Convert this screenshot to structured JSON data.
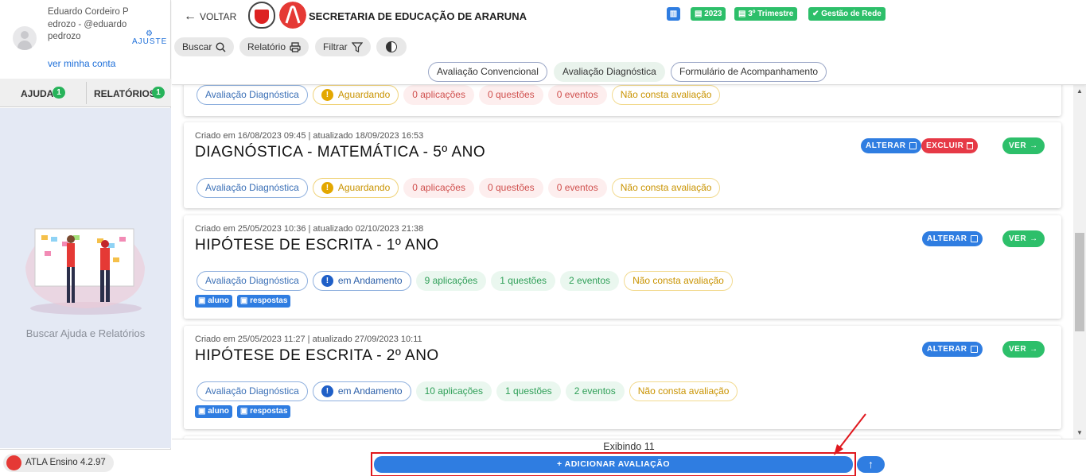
{
  "user": {
    "name": "Eduardo Cordeiro Pedrozo - @eduardopedrozo",
    "account_link": "ver minha conta",
    "settings_label": "AJUSTE"
  },
  "sidebar_tabs": [
    {
      "label": "AJUDA",
      "badge": "1"
    },
    {
      "label": "RELATÓRIOS",
      "badge": "1"
    }
  ],
  "help_text": "Buscar Ajuda e Relatórios",
  "version": "ATLA Ensino 4.2.97",
  "header": {
    "back_label": "VOLTAR",
    "title": "SECRETARIA DE EDUCAÇÃO DE ARARUNA",
    "pills": [
      "2023",
      "3º Trimestre",
      "Gestão de Rede"
    ],
    "tools": [
      "Buscar",
      "Relatório",
      "Filtrar"
    ],
    "segments": [
      "Avaliação Convencional",
      "Avaliação Diagnóstica",
      "Formulário de Acompanhamento"
    ]
  },
  "cards": [
    {
      "meta": "",
      "title": "",
      "chips": [
        "Avaliação Diagnóstica",
        "Aguardando",
        "0 aplicações",
        "0 questões",
        "0 eventos",
        "Não consta avaliação"
      ]
    },
    {
      "meta": "Criado em 16/08/2023 09:45 | atualizado 18/09/2023 16:53",
      "title": "DIAGNÓSTICA - MATEMÁTICA - 5º ANO",
      "chips": [
        "Avaliação Diagnóstica",
        "Aguardando",
        "0 aplicações",
        "0 questões",
        "0 eventos",
        "Não consta avaliação"
      ],
      "actions": [
        "ALTERAR",
        "EXCLUIR",
        "VER"
      ]
    },
    {
      "meta": "Criado em 25/05/2023 10:36 | atualizado 02/10/2023 21:38",
      "title": "HIPÓTESE DE ESCRITA - 1º ANO",
      "chips": [
        "Avaliação Diagnóstica",
        "em Andamento",
        "9 aplicações",
        "1 questões",
        "2 eventos",
        "Não consta avaliação"
      ],
      "tags": [
        "aluno",
        "respostas"
      ],
      "actions": [
        "ALTERAR",
        "VER"
      ]
    },
    {
      "meta": "Criado em 25/05/2023 11:27 | atualizado 27/09/2023 10:11",
      "title": "HIPÓTESE DE ESCRITA - 2º ANO",
      "chips": [
        "Avaliação Diagnóstica",
        "em Andamento",
        "10 aplicações",
        "1 questões",
        "2 eventos",
        "Não consta avaliação"
      ],
      "tags": [
        "aluno",
        "respostas"
      ],
      "actions": [
        "ALTERAR",
        "VER"
      ]
    }
  ],
  "footer": {
    "count_text": "Exibindo 11",
    "add_label": "+ ADICIONAR AVALIAÇÃO"
  },
  "colors": {
    "primary": "#2f7de1",
    "success": "#2dbf6a",
    "danger": "#e63946",
    "warning": "#e3a700",
    "annotation": "#e0181e"
  }
}
